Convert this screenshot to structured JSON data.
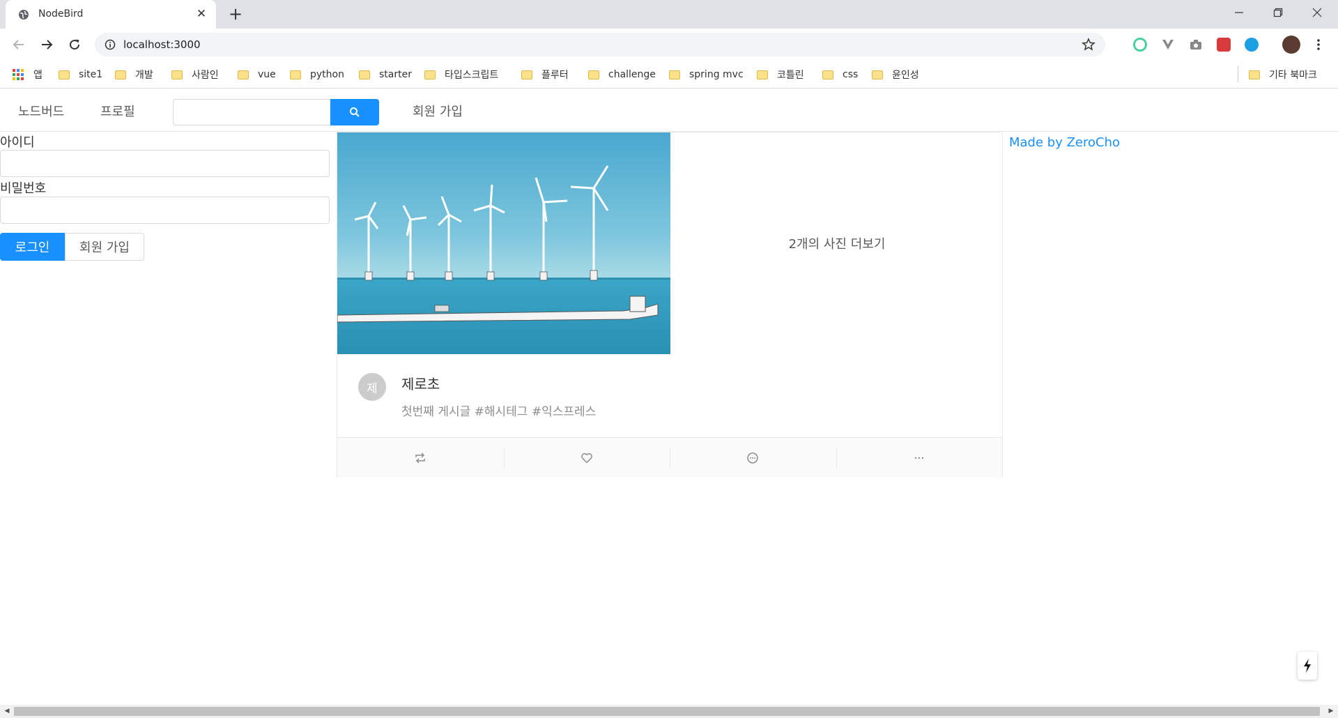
{
  "browser": {
    "tab_title": "NodeBird",
    "url": "localhost:3000",
    "bookmarks": [
      "앱",
      "site1",
      "개발",
      "사람인",
      "vue",
      "python",
      "starter",
      "타입스크립트",
      "플루터",
      "challenge",
      "spring mvc",
      "코틀린",
      "css",
      "윤인성"
    ],
    "other_bookmarks": "기타 북마크"
  },
  "nav": {
    "home": "노드버드",
    "profile": "프로필",
    "search_value": "",
    "signup": "회원 가입"
  },
  "login": {
    "id_label": "아이디",
    "id_value": "",
    "password_label": "비밀번호",
    "password_value": "",
    "login_button": "로그인",
    "signup_button": "회원 가입"
  },
  "post": {
    "more_photos": "2개의 사진 더보기",
    "avatar_initial": "제",
    "author": "제로초",
    "content": "첫번째 게시글 #해시테그 #익스프레스",
    "actions": [
      "retweet-icon",
      "heart-icon",
      "message-icon",
      "ellipsis-icon"
    ]
  },
  "sidebar": {
    "made_by": "Made by ZeroCho"
  },
  "colors": {
    "primary": "#1890ff",
    "bookmark_folder": "#fbe18a"
  }
}
